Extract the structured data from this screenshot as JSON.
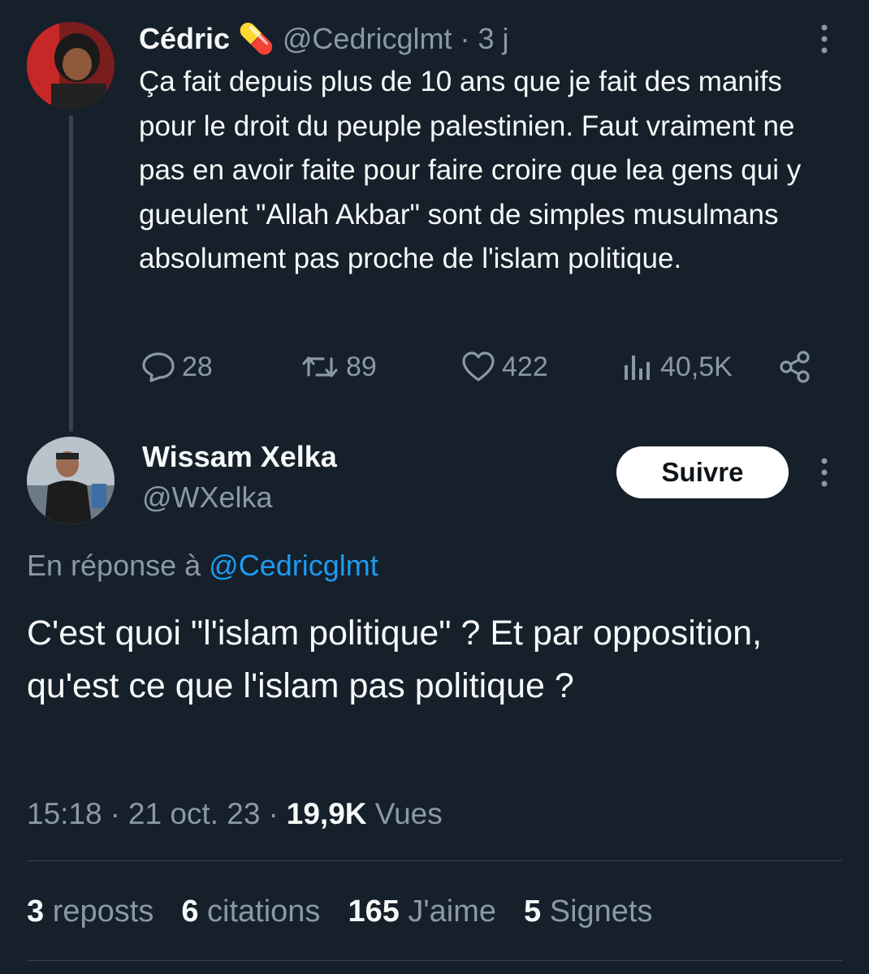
{
  "parent_tweet": {
    "author_name": "Cédric",
    "author_emoji": "💊",
    "handle": "@Cedricglmt",
    "time": "· 3 j",
    "text": "Ça fait depuis plus de 10 ans que je fait des manifs pour le droit du peuple palestinien. Faut vraiment ne pas en avoir faite pour faire croire que lea gens qui y gueulent \"Allah Akbar\" sont de simples musulmans absolument pas proche de l'islam politique.",
    "replies": "28",
    "reposts": "89",
    "likes": "422",
    "views": "40,5K"
  },
  "main_tweet": {
    "author_name": "Wissam Xelka",
    "handle": "@WXelka",
    "follow_label": "Suivre",
    "reply_prefix": "En réponse à",
    "reply_mention": "@Cedricglmt",
    "text": "C'est quoi \"l'islam politique\" ? Et par opposition, qu'est ce que l'islam pas politique ?",
    "time": "15:18",
    "date": "21 oct. 23",
    "views_count": "19,9K",
    "views_label": "Vues",
    "sep": "·"
  },
  "stats": {
    "reposts_count": "3",
    "reposts_label": "reposts",
    "quotes_count": "6",
    "quotes_label": "citations",
    "likes_count": "165",
    "likes_label": "J'aime",
    "bookmarks_count": "5",
    "bookmarks_label": "Signets"
  },
  "colors": {
    "background": "#15202b",
    "text": "#f7f9f9",
    "secondary": "#8b98a5",
    "link": "#1d9bf0",
    "divider": "#38444d"
  }
}
